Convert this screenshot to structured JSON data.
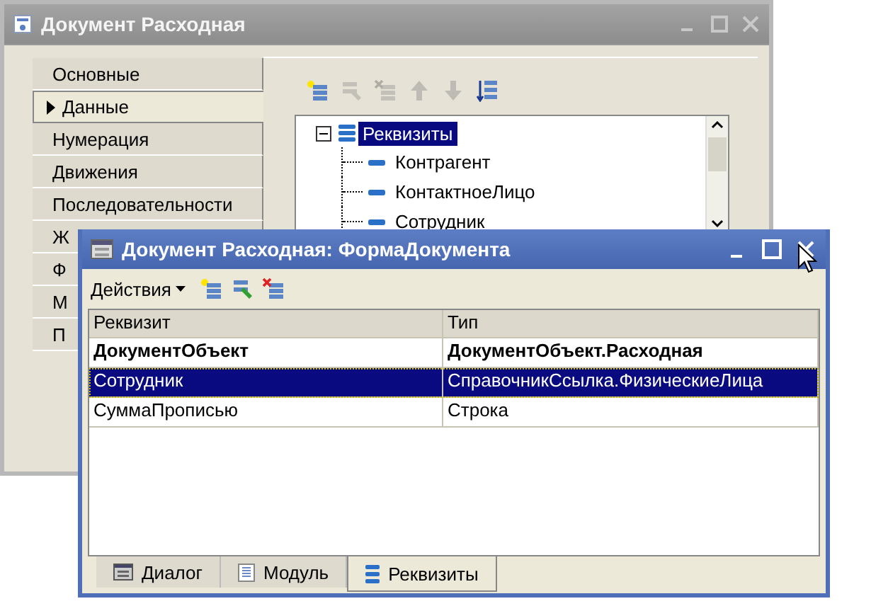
{
  "back_window": {
    "title": "Документ Расходная",
    "sidebar": {
      "items": [
        {
          "label": "Основные",
          "selected": false
        },
        {
          "label": "Данные",
          "selected": true
        },
        {
          "label": "Нумерация",
          "selected": false
        },
        {
          "label": "Движения",
          "selected": false
        },
        {
          "label": "Последовательности",
          "selected": false
        },
        {
          "label": "Ж",
          "selected": false
        },
        {
          "label": "Ф",
          "selected": false
        },
        {
          "label": "М",
          "selected": false
        },
        {
          "label": "П",
          "selected": false
        }
      ]
    },
    "toolbar": [
      {
        "kind": "add",
        "disabled": false
      },
      {
        "kind": "edit",
        "disabled": true
      },
      {
        "kind": "delete",
        "disabled": true
      },
      {
        "kind": "up",
        "disabled": true
      },
      {
        "kind": "down",
        "disabled": true
      },
      {
        "kind": "sort",
        "disabled": false
      }
    ],
    "tree": {
      "label": "Реквизиты",
      "selected": true,
      "expanded": true,
      "children": [
        {
          "label": "Контрагент",
          "selected": false
        },
        {
          "label": "КонтактноеЛицо",
          "selected": false
        },
        {
          "label": "Сотрудник",
          "selected": false
        }
      ]
    }
  },
  "front_window": {
    "title": "Документ Расходная: ФормаДокумента",
    "toolbar": {
      "menu": "Действия",
      "buttons": [
        {
          "kind": "add",
          "disabled": false
        },
        {
          "kind": "edit",
          "disabled": false
        },
        {
          "kind": "delete",
          "disabled": false
        }
      ]
    },
    "table": {
      "columns": [
        "Реквизит",
        "Тип"
      ],
      "rows": [
        {
          "cells": [
            "ДокументОбъект",
            "ДокументОбъект.Расходная"
          ],
          "bold": true,
          "selected": false
        },
        {
          "cells": [
            "Сотрудник",
            "СправочникСсылка.ФизическиеЛица"
          ],
          "bold": false,
          "selected": true
        },
        {
          "cells": [
            "СуммаПрописью",
            "Строка"
          ],
          "bold": false,
          "selected": false
        }
      ]
    },
    "tabs": [
      {
        "label": "Диалог",
        "kind": "dialog",
        "selected": false
      },
      {
        "label": "Модуль",
        "kind": "module",
        "selected": false
      },
      {
        "label": "Реквизиты",
        "kind": "attributes",
        "selected": true
      }
    ]
  }
}
